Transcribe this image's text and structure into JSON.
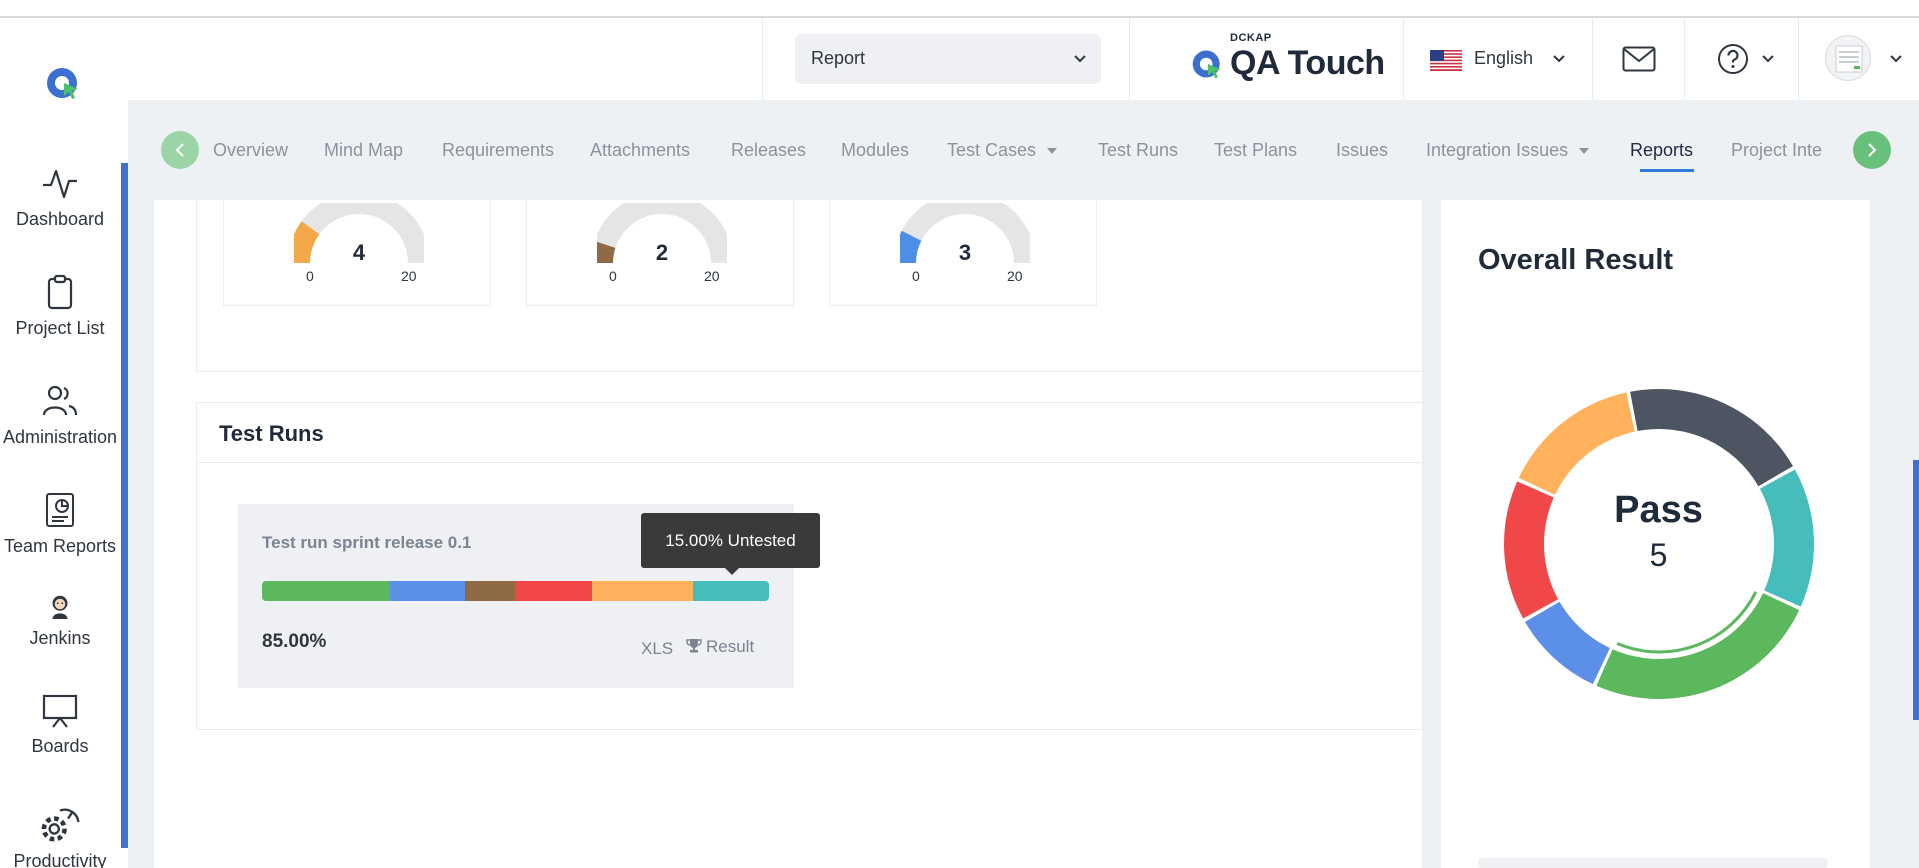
{
  "header": {
    "report_select": "Report",
    "brand_small": "DCKAP",
    "brand_name": "QA Touch",
    "language": "English"
  },
  "sidebar": {
    "items": [
      {
        "label": "Dashboard",
        "icon": "activity-icon"
      },
      {
        "label": "Project List",
        "icon": "clipboard-icon"
      },
      {
        "label": "Administration",
        "icon": "users-icon"
      },
      {
        "label": "Team Reports",
        "icon": "report-icon"
      },
      {
        "label": "Jenkins",
        "icon": "jenkins-icon"
      },
      {
        "label": "Boards",
        "icon": "board-icon"
      },
      {
        "label": "Productivity",
        "icon": "gear-gauge-icon"
      }
    ]
  },
  "tabs": {
    "items": [
      "Overview",
      "Mind Map",
      "Requirements",
      "Attachments",
      "Releases",
      "Modules",
      "Test Cases",
      "Test Runs",
      "Test Plans",
      "Issues",
      "Integration Issues",
      "Reports",
      "Project Inte"
    ],
    "active": "Reports"
  },
  "gauges": [
    {
      "value": "4",
      "min": "0",
      "max": "20",
      "color": "#f3a94a",
      "fraction": 0.2
    },
    {
      "value": "2",
      "min": "0",
      "max": "20",
      "color": "#8f6a45",
      "fraction": 0.1
    },
    {
      "value": "3",
      "min": "0",
      "max": "20",
      "color": "#4f8ee6",
      "fraction": 0.15
    }
  ],
  "test_runs": {
    "title": "Test Runs",
    "run": {
      "name": "Test run sprint release 0.1",
      "percent": "85.00%",
      "xls_label": "XLS",
      "result_label": "Result",
      "tooltip": "15.00% Untested",
      "segments": [
        {
          "color": "#5cb85c",
          "percent": 25
        },
        {
          "color": "#5b8fe8",
          "percent": 15
        },
        {
          "color": "#8f6a45",
          "percent": 10
        },
        {
          "color": "#f04848",
          "percent": 15
        },
        {
          "color": "#ffb15c",
          "percent": 20
        },
        {
          "color": "#45bdbd",
          "percent": 15
        }
      ]
    }
  },
  "overall": {
    "title": "Overall Result",
    "center_label": "Pass",
    "center_count": "5",
    "slices": [
      {
        "color": "#4d5563",
        "percent": 20
      },
      {
        "color": "#45bdbd",
        "percent": 15
      },
      {
        "color": "#5cb85c",
        "percent": 25
      },
      {
        "color": "#5b8fe8",
        "percent": 10
      },
      {
        "color": "#f04848",
        "percent": 15
      },
      {
        "color": "#ffb15c",
        "percent": 15
      }
    ]
  }
}
